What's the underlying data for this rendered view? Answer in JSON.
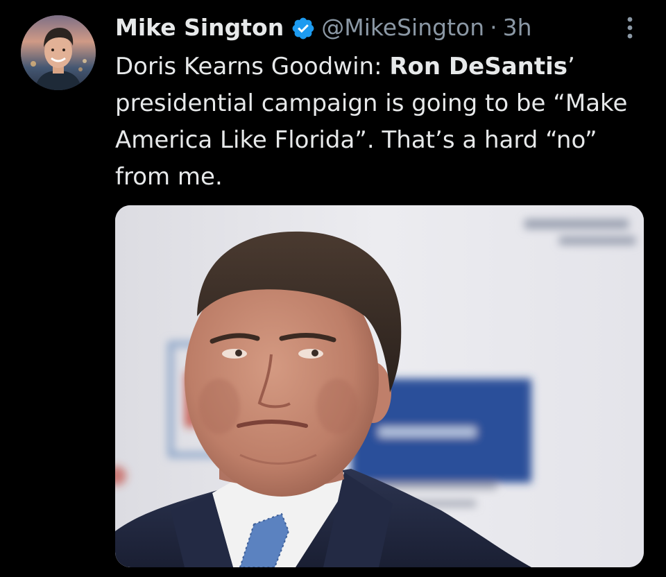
{
  "tweet": {
    "author": {
      "display_name": "Mike Sington",
      "handle": "@MikeSington",
      "verified": true,
      "avatar_icon": "user-avatar"
    },
    "separator": "·",
    "timestamp": "3h",
    "more_icon": "vertical-ellipsis-icon",
    "text": {
      "part1": "Doris Kearns Goodwin: ",
      "bold": "Ron DeSantis",
      "part2": "’ presidential campaign is going to be “Make America Like Florida”. That’s a hard “no” from me."
    },
    "media": {
      "kind": "photo",
      "description_icon": "press-photo"
    }
  },
  "colors": {
    "background": "#000000",
    "text": "#e7e9ea",
    "secondary_text": "#8b98a5",
    "verified_badge": "#1d9bf0",
    "banner_blue": "#2a4f9a"
  }
}
